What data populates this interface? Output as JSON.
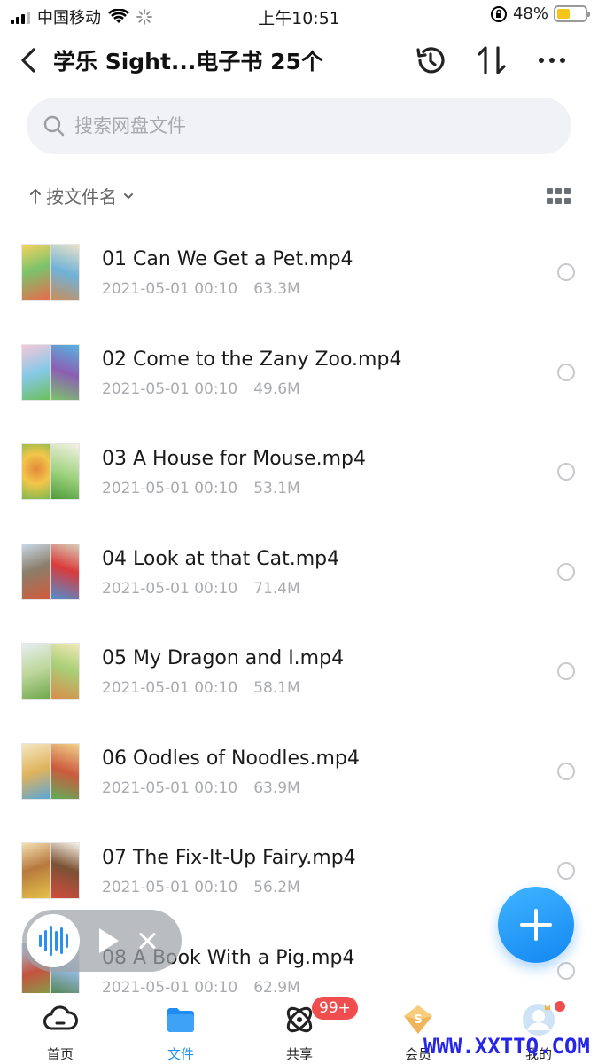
{
  "status_bar": {
    "carrier": "中国移动",
    "time": "上午10:51",
    "battery": "48%",
    "battery_level": 0.48
  },
  "header": {
    "title": "学乐 Sight...电子书 25个"
  },
  "search": {
    "placeholder": "搜索网盘文件"
  },
  "sort": {
    "label": "按文件名"
  },
  "files": [
    {
      "name": "01 Can We Get a Pet.mp4",
      "date": "2021-05-01 00:10",
      "size": "63.3M"
    },
    {
      "name": "02 Come to the Zany Zoo.mp4",
      "date": "2021-05-01 00:10",
      "size": "49.6M"
    },
    {
      "name": "03 A House for Mouse.mp4",
      "date": "2021-05-01 00:10",
      "size": "53.1M"
    },
    {
      "name": "04 Look at that Cat.mp4",
      "date": "2021-05-01 00:10",
      "size": "71.4M"
    },
    {
      "name": "05 My Dragon and I.mp4",
      "date": "2021-05-01 00:10",
      "size": "58.1M"
    },
    {
      "name": "06 Oodles of Noodles.mp4",
      "date": "2021-05-01 00:10",
      "size": "63.9M"
    },
    {
      "name": "07 The Fix-It-Up Fairy.mp4",
      "date": "2021-05-01 00:10",
      "size": "56.2M"
    },
    {
      "name": "08 A Book With a Pig.mp4",
      "date": "2021-05-01 00:10",
      "size": "62.9M"
    }
  ],
  "tabs": [
    {
      "label": "首页",
      "icon": "cloud-home-icon"
    },
    {
      "label": "文件",
      "icon": "folder-icon"
    },
    {
      "label": "共享",
      "icon": "share-orbit-icon"
    },
    {
      "label": "会员",
      "icon": "vip-diamond-icon"
    },
    {
      "label": "我的",
      "icon": "avatar-icon"
    }
  ],
  "badges": {
    "share_count": "99+"
  },
  "colors": {
    "accent": "#1e8df2",
    "badge": "#f04e4e",
    "watermark": "#2626e8"
  },
  "watermark": "WWW.XXTTQ.COM"
}
